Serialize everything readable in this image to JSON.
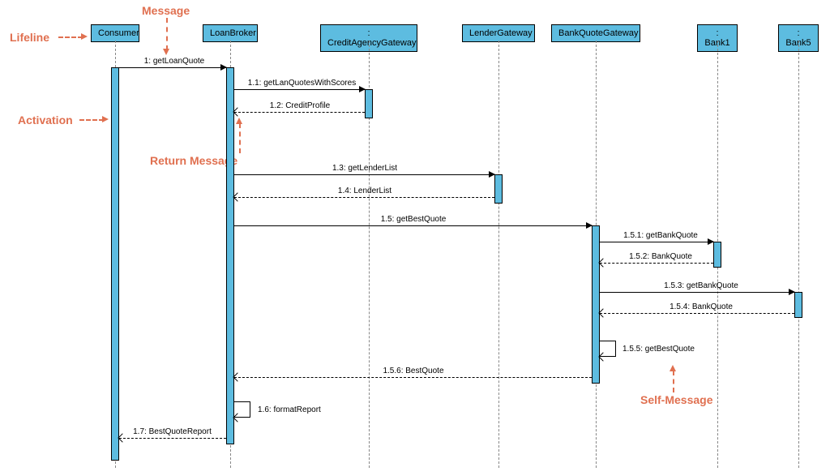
{
  "annotations": {
    "lifeline": "Lifeline",
    "message": "Message",
    "activation": "Activation",
    "return_message": "Return Message",
    "self_message": "Self-Message"
  },
  "participants": {
    "p0": "Consumer",
    "p1": "LoanBroker",
    "p2": ": CreditAgencyGateway",
    "p3": "LenderGateway",
    "p4": "BankQuoteGateway",
    "p5": ": Bank1",
    "p6": ": Bank5"
  },
  "messages": {
    "m1": "1: getLoanQuote",
    "m1_1": "1.1: getLanQuotesWithScores",
    "m1_2": "1.2: CreditProfile",
    "m1_3": "1.3: getLenderList",
    "m1_4": "1.4: LenderList",
    "m1_5": "1.5: getBestQuote",
    "m1_5_1": "1.5.1: getBankQuote",
    "m1_5_2": "1.5.2: BankQuote",
    "m1_5_3": "1.5.3: getBankQuote",
    "m1_5_4": "1.5.4: BankQuote",
    "m1_5_5": "1.5.5: getBestQuote",
    "m1_5_6": "1.5.6: BestQuote",
    "m1_6": "1.6: formatReport",
    "m1_7": "1.7: BestQuoteReport"
  },
  "chart_data": {
    "type": "uml_sequence_diagram",
    "participants": [
      "Consumer",
      "LoanBroker",
      ": CreditAgencyGateway",
      "LenderGateway",
      "BankQuoteGateway",
      ": Bank1",
      ": Bank5"
    ],
    "interactions": [
      {
        "seq": "1",
        "from": "Consumer",
        "to": "LoanBroker",
        "label": "getLoanQuote",
        "type": "call"
      },
      {
        "seq": "1.1",
        "from": "LoanBroker",
        "to": ": CreditAgencyGateway",
        "label": "getLanQuotesWithScores",
        "type": "call"
      },
      {
        "seq": "1.2",
        "from": ": CreditAgencyGateway",
        "to": "LoanBroker",
        "label": "CreditProfile",
        "type": "return"
      },
      {
        "seq": "1.3",
        "from": "LoanBroker",
        "to": "LenderGateway",
        "label": "getLenderList",
        "type": "call"
      },
      {
        "seq": "1.4",
        "from": "LenderGateway",
        "to": "LoanBroker",
        "label": "LenderList",
        "type": "return"
      },
      {
        "seq": "1.5",
        "from": "LoanBroker",
        "to": "BankQuoteGateway",
        "label": "getBestQuote",
        "type": "call"
      },
      {
        "seq": "1.5.1",
        "from": "BankQuoteGateway",
        "to": ": Bank1",
        "label": "getBankQuote",
        "type": "call"
      },
      {
        "seq": "1.5.2",
        "from": ": Bank1",
        "to": "BankQuoteGateway",
        "label": "BankQuote",
        "type": "return"
      },
      {
        "seq": "1.5.3",
        "from": "BankQuoteGateway",
        "to": ": Bank5",
        "label": "getBankQuote",
        "type": "call"
      },
      {
        "seq": "1.5.4",
        "from": ": Bank5",
        "to": "BankQuoteGateway",
        "label": "BankQuote",
        "type": "return"
      },
      {
        "seq": "1.5.5",
        "from": "BankQuoteGateway",
        "to": "BankQuoteGateway",
        "label": "getBestQuote",
        "type": "self"
      },
      {
        "seq": "1.5.6",
        "from": "BankQuoteGateway",
        "to": "LoanBroker",
        "label": "BestQuote",
        "type": "return"
      },
      {
        "seq": "1.6",
        "from": "LoanBroker",
        "to": "LoanBroker",
        "label": "formatReport",
        "type": "self"
      },
      {
        "seq": "1.7",
        "from": "LoanBroker",
        "to": "Consumer",
        "label": "BestQuoteReport",
        "type": "return"
      }
    ],
    "annotations": [
      "Lifeline",
      "Message",
      "Activation",
      "Return Message",
      "Self-Message"
    ]
  }
}
